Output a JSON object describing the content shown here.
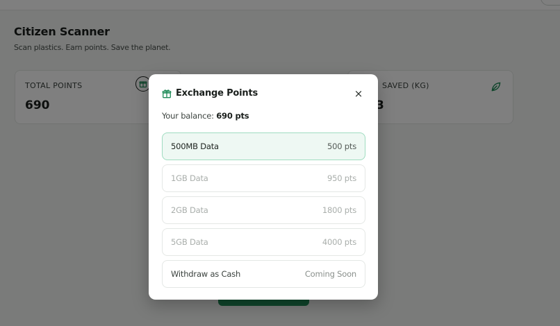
{
  "app": {
    "title": "Citizen Scanner",
    "subtitle": "Scan plastics. Earn points. Save the planet."
  },
  "stats": {
    "total_points": {
      "label": "TOTAL POINTS",
      "value": "690",
      "icon": "gift-icon"
    },
    "saved": {
      "label": "SAVED (KG)",
      "value": "3",
      "icon": "leaf-icon"
    }
  },
  "modal": {
    "title": "Exchange Points",
    "title_icon": "gift-icon",
    "close_icon": "close-icon",
    "close_glyph": "×",
    "balance_label": "Your balance:",
    "balance_value": "690 pts",
    "options": [
      {
        "name": "500MB Data",
        "cost": "500 pts",
        "state": "selected"
      },
      {
        "name": "1GB Data",
        "cost": "950 pts",
        "state": "disabled"
      },
      {
        "name": "2GB Data",
        "cost": "1800 pts",
        "state": "disabled"
      },
      {
        "name": "5GB Data",
        "cost": "4000 pts",
        "state": "disabled"
      },
      {
        "name": "Withdraw as Cash",
        "cost": "Coming Soon",
        "state": "disabled"
      }
    ]
  },
  "colors": {
    "accent": "#1e8a57",
    "selected_bg": "#eef8f3",
    "selected_border": "#9fdcc0"
  }
}
